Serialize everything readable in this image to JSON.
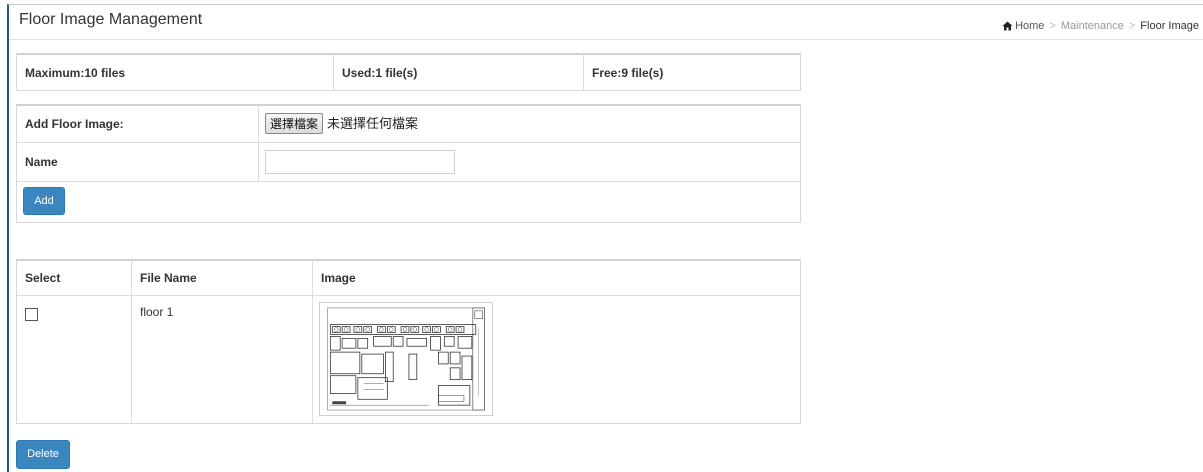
{
  "header": {
    "title": "Floor Image Management",
    "breadcrumb": {
      "home": "Home",
      "maintenance": "Maintenance",
      "current": "Floor Image",
      "separator": ">"
    }
  },
  "capacity": {
    "maximum": "Maximum:10 files",
    "used": "Used:1 file(s)",
    "free": "Free:9 file(s)"
  },
  "add_form": {
    "add_floor_image_label": "Add Floor Image:",
    "choose_file_button": "選擇檔案",
    "no_file_chosen": "未選擇任何檔案",
    "name_label": "Name",
    "name_value": "",
    "add_button": "Add"
  },
  "files_table": {
    "columns": [
      "Select",
      "File Name",
      "Image"
    ],
    "rows": [
      {
        "file_name": "floor 1",
        "selected": false,
        "image_icon": "floor-plan-thumbnail"
      }
    ]
  },
  "delete_button": "Delete",
  "colors": {
    "button_blue": "#3a87c0",
    "frame_accent": "#1f5c8a"
  }
}
